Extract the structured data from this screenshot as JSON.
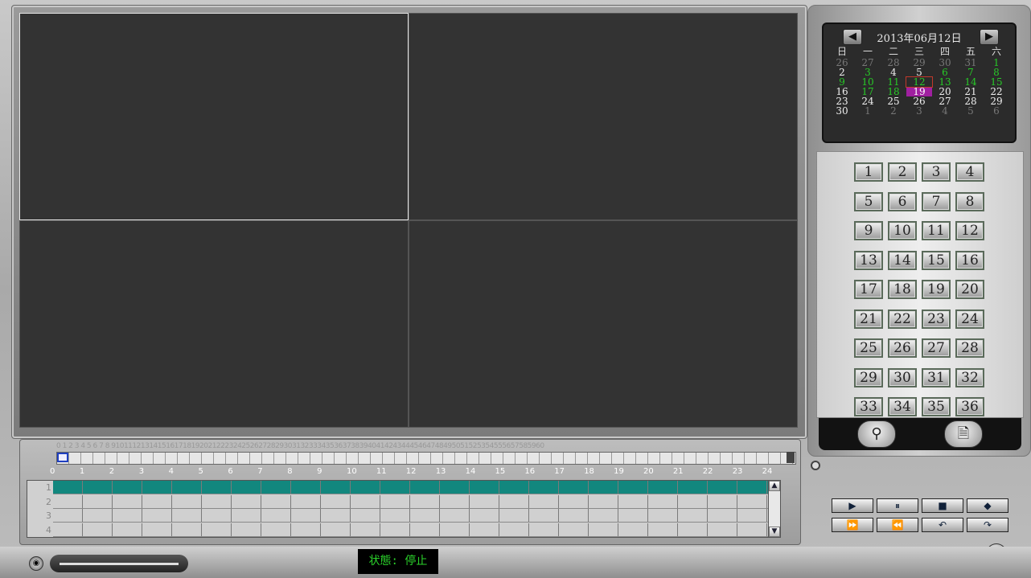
{
  "calendar": {
    "title": "2013年06月12日",
    "prev_icon": "arrow-left-icon",
    "next_icon": "arrow-right-icon",
    "weekdays": [
      "日",
      "一",
      "二",
      "三",
      "四",
      "五",
      "六"
    ],
    "weeks": [
      [
        {
          "d": "26",
          "t": "other"
        },
        {
          "d": "27",
          "t": "other"
        },
        {
          "d": "28",
          "t": "other"
        },
        {
          "d": "29",
          "t": "other"
        },
        {
          "d": "30",
          "t": "other"
        },
        {
          "d": "31",
          "t": "other"
        },
        {
          "d": "1",
          "t": "rec"
        }
      ],
      [
        {
          "d": "2",
          "t": "normal"
        },
        {
          "d": "3",
          "t": "rec"
        },
        {
          "d": "4",
          "t": "normal"
        },
        {
          "d": "5",
          "t": "normal"
        },
        {
          "d": "6",
          "t": "rec"
        },
        {
          "d": "7",
          "t": "rec"
        },
        {
          "d": "8",
          "t": "rec"
        }
      ],
      [
        {
          "d": "9",
          "t": "rec"
        },
        {
          "d": "10",
          "t": "rec"
        },
        {
          "d": "11",
          "t": "rec"
        },
        {
          "d": "12",
          "t": "rec",
          "selected": true
        },
        {
          "d": "13",
          "t": "rec"
        },
        {
          "d": "14",
          "t": "rec"
        },
        {
          "d": "15",
          "t": "rec"
        }
      ],
      [
        {
          "d": "16",
          "t": "normal"
        },
        {
          "d": "17",
          "t": "rec"
        },
        {
          "d": "18",
          "t": "rec"
        },
        {
          "d": "19",
          "t": "hl"
        },
        {
          "d": "20",
          "t": "normal"
        },
        {
          "d": "21",
          "t": "normal"
        },
        {
          "d": "22",
          "t": "normal"
        }
      ],
      [
        {
          "d": "23",
          "t": "normal"
        },
        {
          "d": "24",
          "t": "normal"
        },
        {
          "d": "25",
          "t": "normal"
        },
        {
          "d": "26",
          "t": "normal"
        },
        {
          "d": "27",
          "t": "normal"
        },
        {
          "d": "28",
          "t": "normal"
        },
        {
          "d": "29",
          "t": "normal"
        }
      ],
      [
        {
          "d": "30",
          "t": "normal"
        },
        {
          "d": "1",
          "t": "other"
        },
        {
          "d": "2",
          "t": "other"
        },
        {
          "d": "3",
          "t": "other"
        },
        {
          "d": "4",
          "t": "other"
        },
        {
          "d": "5",
          "t": "other"
        },
        {
          "d": "6",
          "t": "other"
        }
      ]
    ]
  },
  "channels": [
    "1",
    "2",
    "3",
    "4",
    "5",
    "6",
    "7",
    "8",
    "9",
    "10",
    "11",
    "12",
    "13",
    "14",
    "15",
    "16",
    "17",
    "18",
    "19",
    "20",
    "21",
    "22",
    "23",
    "24",
    "25",
    "26",
    "27",
    "28",
    "29",
    "30",
    "31",
    "32",
    "33",
    "34",
    "35",
    "36"
  ],
  "tools": [
    {
      "icon": "search-icon",
      "glyph": "⚲"
    },
    {
      "icon": "file-search-icon",
      "glyph": "🗎"
    }
  ],
  "timeline": {
    "minute_labels": "0 1 2 3 4 5 6 7 8 9101112131415161718192021222324252627282930313233343536373839404142434445464748495051525354555657585960",
    "hours": [
      "0",
      "1",
      "2",
      "3",
      "4",
      "5",
      "6",
      "7",
      "8",
      "9",
      "10",
      "11",
      "12",
      "13",
      "14",
      "15",
      "16",
      "17",
      "18",
      "19",
      "20",
      "21",
      "22",
      "23",
      "24"
    ],
    "rows": [
      {
        "label": "1",
        "recording": true
      },
      {
        "label": "2",
        "recording": false
      },
      {
        "label": "3",
        "recording": false
      },
      {
        "label": "4",
        "recording": false
      }
    ],
    "scroll_up": "▲",
    "scroll_down": "▼"
  },
  "playback": [
    {
      "name": "play-icon",
      "glyph": "▶"
    },
    {
      "name": "pause-icon",
      "glyph": "⏸"
    },
    {
      "name": "stop-icon",
      "glyph": "■"
    },
    {
      "name": "snapshot-icon",
      "glyph": "◆"
    },
    {
      "name": "fast-forward-icon",
      "glyph": "⏩"
    },
    {
      "name": "rewind-icon",
      "glyph": "⏪"
    },
    {
      "name": "step-back-icon",
      "glyph": "↶"
    },
    {
      "name": "step-forward-icon",
      "glyph": "↷"
    }
  ],
  "power_icon": "⏻",
  "status": "状態: 停止"
}
